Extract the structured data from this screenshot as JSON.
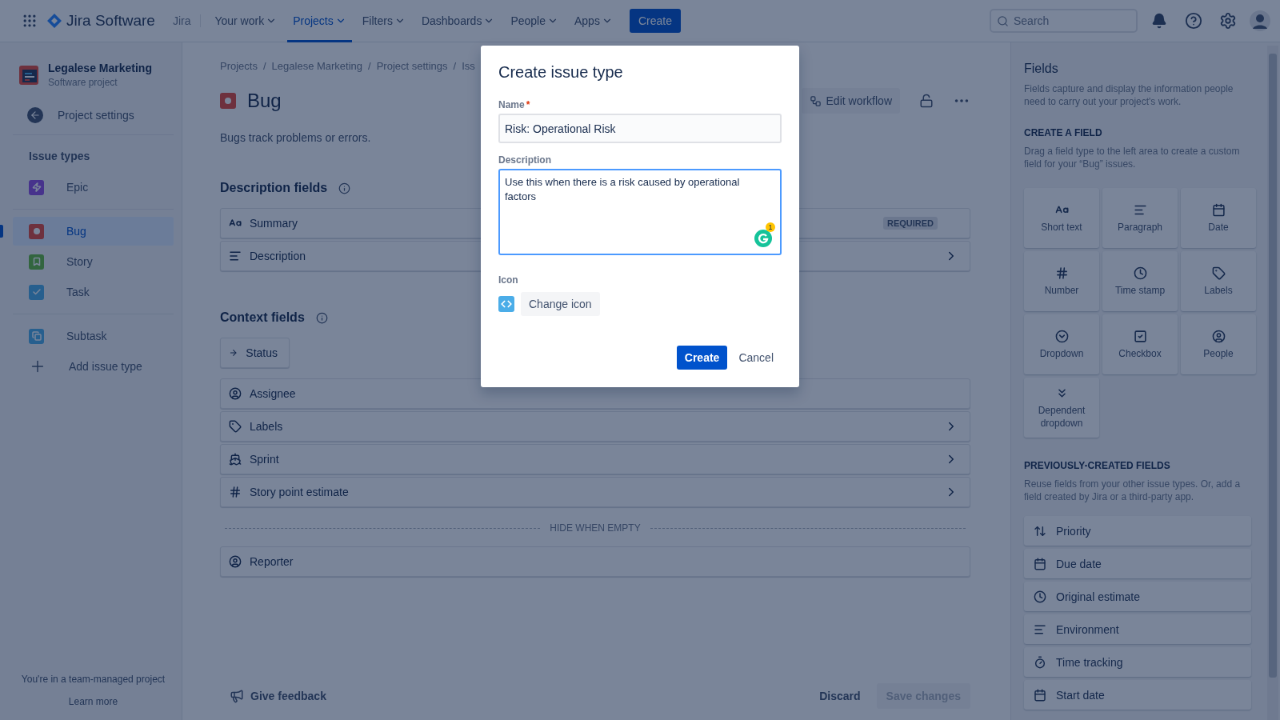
{
  "nav": {
    "logo": "Jira Software",
    "product": "Jira",
    "items": [
      {
        "label": "Your work",
        "selected": false
      },
      {
        "label": "Projects",
        "selected": true
      },
      {
        "label": "Filters",
        "selected": false
      },
      {
        "label": "Dashboards",
        "selected": false
      },
      {
        "label": "People",
        "selected": false
      },
      {
        "label": "Apps",
        "selected": false
      }
    ],
    "create": "Create",
    "search": {
      "placeholder": "Search"
    }
  },
  "sidebar": {
    "project_name": "Legalese Marketing",
    "project_type": "Software project",
    "back": "Project settings",
    "section": "Issue types",
    "groups": [
      {
        "items": [
          {
            "label": "Epic",
            "kind": "epic",
            "selected": false
          }
        ]
      },
      {
        "items": [
          {
            "label": "Bug",
            "kind": "bug",
            "selected": true
          },
          {
            "label": "Story",
            "kind": "story",
            "selected": false
          },
          {
            "label": "Task",
            "kind": "task",
            "selected": false
          }
        ]
      },
      {
        "items": [
          {
            "label": "Subtask",
            "kind": "subtask",
            "selected": false
          }
        ]
      }
    ],
    "add": "Add issue type",
    "footer_note": "You're in a team-managed project",
    "learn_more": "Learn more"
  },
  "main": {
    "breadcrumbs": [
      "Projects",
      "/",
      "Legalese Marketing",
      "/",
      "Project settings",
      "/",
      "Iss"
    ],
    "title": "Bug",
    "edit_workflow": "Edit workflow",
    "description": "Bugs track problems or errors.",
    "description_fields": {
      "title": "Description fields",
      "fields": [
        {
          "label": "Summary",
          "kind": "text",
          "badge": "REQUIRED",
          "chevron": false,
          "compact": false
        },
        {
          "label": "Description",
          "kind": "paragraph",
          "chevron": true,
          "compact": false
        }
      ]
    },
    "context_fields": {
      "title": "Context fields",
      "fields": [
        {
          "label": "Status",
          "kind": "arrow",
          "chevron": false,
          "compact": true
        },
        {
          "label": "Assignee",
          "kind": "person",
          "chevron": false,
          "compact": false
        },
        {
          "label": "Labels",
          "kind": "tag",
          "chevron": true,
          "compact": false
        },
        {
          "label": "Sprint",
          "kind": "ship",
          "chevron": true,
          "compact": false
        },
        {
          "label": "Story point estimate",
          "kind": "number",
          "chevron": true,
          "compact": false
        }
      ]
    },
    "hide_label": "HIDE WHEN EMPTY",
    "hidden_fields": [
      {
        "label": "Reporter",
        "kind": "person",
        "chevron": false,
        "compact": false
      }
    ],
    "feedback": "Give feedback",
    "discard": "Discard",
    "save": {
      "label": "Save changes",
      "disabled": true
    }
  },
  "panel": {
    "title": "Fields",
    "intro": "Fields capture and display the information people need to carry out your project's work.",
    "create_heading": "CREATE A FIELD",
    "create_hint": "Drag a field type to the left area to create a custom field for your “Bug” issues.",
    "field_types": [
      {
        "label": "Short text",
        "kind": "text"
      },
      {
        "label": "Paragraph",
        "kind": "paragraph"
      },
      {
        "label": "Date",
        "kind": "calendar"
      },
      {
        "label": "Number",
        "kind": "number"
      },
      {
        "label": "Time stamp",
        "kind": "clock"
      },
      {
        "label": "Labels",
        "kind": "tag"
      },
      {
        "label": "Dropdown",
        "kind": "dropdown"
      },
      {
        "label": "Checkbox",
        "kind": "checkbox"
      },
      {
        "label": "People",
        "kind": "person"
      },
      {
        "label": "Dependent dropdown",
        "kind": "dependent"
      }
    ],
    "previous_heading": "PREVIOUSLY-CREATED FIELDS",
    "previous_hint": "Reuse fields from your other issue types. Or, add a field created by Jira or a third-party app.",
    "previous_fields": [
      {
        "label": "Priority",
        "kind": "priority"
      },
      {
        "label": "Due date",
        "kind": "calendar"
      },
      {
        "label": "Original estimate",
        "kind": "clock"
      },
      {
        "label": "Environment",
        "kind": "paragraph"
      },
      {
        "label": "Time tracking",
        "kind": "timer"
      },
      {
        "label": "Start date",
        "kind": "calendar"
      }
    ]
  },
  "modal": {
    "title": "Create issue type",
    "name_label": "Name",
    "required_mark": "*",
    "name_value": "Risk: Operational Risk",
    "description_label": "Description",
    "description_value": "Use this when there is a risk caused by operational factors",
    "grammarly_count": "1",
    "icon_label": "Icon",
    "change_icon": "Change icon",
    "create": "Create",
    "cancel": "Cancel"
  }
}
